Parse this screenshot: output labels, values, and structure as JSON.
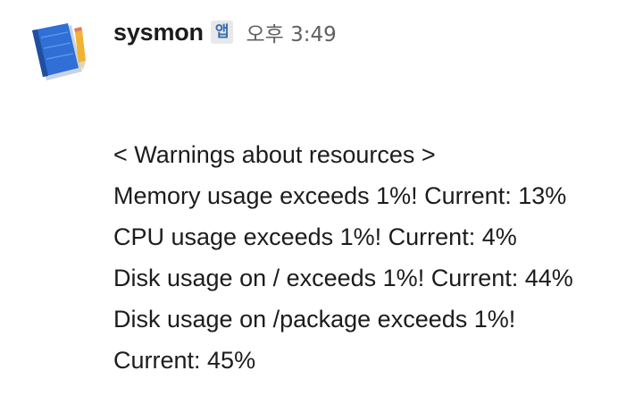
{
  "message": {
    "sender": "sysmon",
    "badge": "앱",
    "timestamp": "오후 3:49",
    "avatar_icon": "notebook-icon",
    "lines": [
      "< Warnings about resources >",
      "Memory usage exceeds 1%! Current: 13%",
      "CPU usage exceeds 1%! Current: 4%",
      "Disk usage on / exceeds 1%! Current: 44%",
      "Disk usage on /package exceeds 1%!",
      "Current: 45%"
    ]
  },
  "colors": {
    "text": "#1d1c1d",
    "muted": "#616061",
    "badge_text": "#3a6fb0",
    "badge_bg": "#e8e8e8",
    "avatar_book": "#2f6fd6",
    "avatar_pencil": "#f2b233"
  }
}
